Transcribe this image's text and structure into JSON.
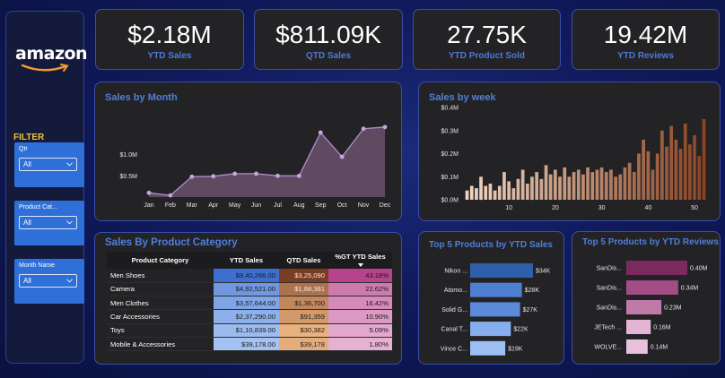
{
  "brand": {
    "logo": "amazon"
  },
  "filter": {
    "title": "FILTER",
    "slicers": [
      {
        "label": "Qtr",
        "value": "All"
      },
      {
        "label": "Product Cat...",
        "value": "All"
      },
      {
        "label": "Month Name",
        "value": "All"
      }
    ]
  },
  "kpis": [
    {
      "value": "$2.18M",
      "label": "YTD Sales"
    },
    {
      "value": "$811.09K",
      "label": "QTD Sales"
    },
    {
      "value": "27.75K",
      "label": "YTD Product Sold"
    },
    {
      "value": "19.42M",
      "label": "YTD Reviews"
    }
  ],
  "colors": {
    "accent": "#4f7fdc",
    "month_fill": "#5e4b62",
    "month_line": "#b48ccb",
    "top_sales_bar": "#4f84d8",
    "top_reviews_bar": "#a8407f",
    "filter_title": "#f0c43a",
    "slicer_bg": "#2e6fd8"
  },
  "chart_data": [
    {
      "id": "sales_by_month",
      "type": "area",
      "title": "Sales by Month",
      "categories": [
        "Jan",
        "Feb",
        "Mar",
        "Apr",
        "May",
        "Jun",
        "Jul",
        "Aug",
        "Sep",
        "Oct",
        "Nov",
        "Dec"
      ],
      "values": [
        0.1,
        0.04,
        0.48,
        0.49,
        0.55,
        0.55,
        0.5,
        0.5,
        1.52,
        0.95,
        1.61,
        1.65
      ],
      "yticks": [
        "$0.5M",
        "$1.0M"
      ],
      "ytick_values": [
        0.5,
        1.0
      ],
      "ylim": [
        0,
        1.9
      ],
      "unit": "$M"
    },
    {
      "id": "sales_by_week",
      "type": "bar",
      "title": "Sales by week",
      "x": [
        1,
        2,
        3,
        4,
        5,
        6,
        7,
        8,
        9,
        10,
        11,
        12,
        13,
        14,
        15,
        16,
        17,
        18,
        19,
        20,
        21,
        22,
        23,
        24,
        25,
        26,
        27,
        28,
        29,
        30,
        31,
        32,
        33,
        34,
        35,
        36,
        37,
        38,
        39,
        40,
        41,
        42,
        43,
        44,
        45,
        46,
        47,
        48,
        49,
        50,
        51,
        52
      ],
      "values": [
        0.04,
        0.06,
        0.05,
        0.1,
        0.06,
        0.07,
        0.04,
        0.06,
        0.12,
        0.08,
        0.05,
        0.09,
        0.13,
        0.07,
        0.1,
        0.12,
        0.09,
        0.15,
        0.11,
        0.13,
        0.1,
        0.14,
        0.1,
        0.12,
        0.13,
        0.11,
        0.14,
        0.12,
        0.13,
        0.14,
        0.12,
        0.13,
        0.1,
        0.11,
        0.14,
        0.16,
        0.12,
        0.2,
        0.26,
        0.21,
        0.13,
        0.2,
        0.3,
        0.23,
        0.32,
        0.26,
        0.22,
        0.33,
        0.24,
        0.28,
        0.19,
        0.35
      ],
      "xticks": [
        10,
        20,
        30,
        40,
        50
      ],
      "yticks": [
        "$0.0M",
        "$0.1M",
        "$0.2M",
        "$0.3M",
        "$0.4M"
      ],
      "ytick_values": [
        0,
        0.1,
        0.2,
        0.3,
        0.4
      ],
      "ylim": [
        0,
        0.4
      ],
      "unit": "$M"
    },
    {
      "id": "top5_products_ytd_sales",
      "type": "bar",
      "orientation": "horizontal",
      "title": "Top 5 Products by YTD Sales",
      "categories": [
        "Nikon ...",
        "Atomo...",
        "Solid G...",
        "Canal T...",
        "Vince C..."
      ],
      "values": [
        34,
        28,
        27,
        22,
        19
      ],
      "labels": [
        "$34K",
        "$28K",
        "$27K",
        "$22K",
        "$19K"
      ],
      "unit": "$K"
    },
    {
      "id": "top5_products_ytd_reviews",
      "type": "bar",
      "orientation": "horizontal",
      "title": "Top 5 Products by YTD Reviews",
      "categories": [
        "SanDis...",
        "SanDis...",
        "SanDis...",
        "JETech ...",
        "WOLVE..."
      ],
      "values": [
        0.4,
        0.34,
        0.23,
        0.16,
        0.14
      ],
      "labels": [
        "0.40M",
        "0.34M",
        "0.23M",
        "0.16M",
        "0.14M"
      ],
      "unit": "M"
    },
    {
      "id": "sales_by_product_category",
      "type": "table",
      "title": "Sales By Product Category",
      "columns": [
        "Product Category",
        "YTD Sales",
        "QTD Sales",
        "%GT YTD Sales"
      ],
      "rows": [
        [
          "Men Shoes",
          "$9,40,266.00",
          "$3,25,090",
          "43.18%"
        ],
        [
          "Camera",
          "$4,92,521.00",
          "$1,88,381",
          "22.62%"
        ],
        [
          "Men Clothes",
          "$3,57,644.00",
          "$1,36,700",
          "16.42%"
        ],
        [
          "Car Accessories",
          "$2,37,290.00",
          "$91,359",
          "10.90%"
        ],
        [
          "Toys",
          "$1,10,839.00",
          "$30,382",
          "5.09%"
        ],
        [
          "Mobile & Accessories",
          "$39,178.00",
          "$39,178",
          "1.80%"
        ]
      ],
      "ytd_values": [
        940266,
        492521,
        357644,
        237290,
        110839,
        39178
      ],
      "qtd_values": [
        325090,
        188381,
        136700,
        91359,
        30382,
        39178
      ],
      "pct_values": [
        43.18,
        22.62,
        16.42,
        10.9,
        5.09,
        1.8
      ]
    }
  ]
}
